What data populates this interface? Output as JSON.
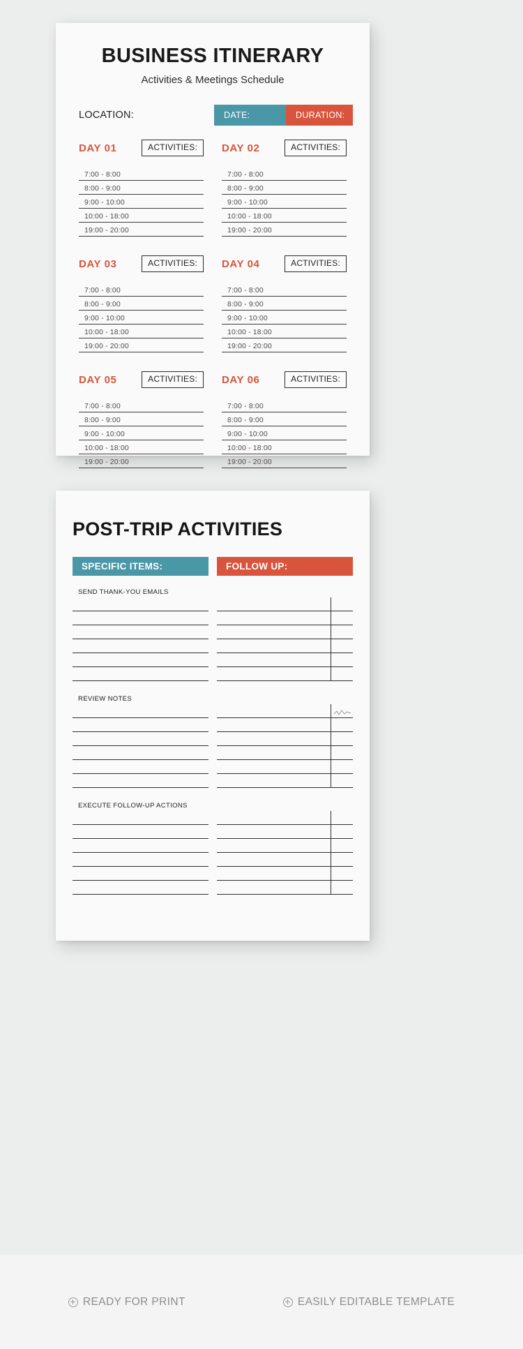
{
  "page1": {
    "title": "BUSINESS ITINERARY",
    "subtitle": "Activities & Meetings Schedule",
    "location_label": "LOCATION:",
    "date_label": "DATE:",
    "duration_label": "DURATION:",
    "activities_label": "ACTIVITIES:",
    "time_slots": [
      "7:00 - 8:00",
      "8:00 - 9:00",
      "9:00 - 10:00",
      "10:00 - 18:00",
      "19:00 - 20:00"
    ],
    "days": [
      {
        "name": "DAY 01"
      },
      {
        "name": "DAY 02"
      },
      {
        "name": "DAY 03"
      },
      {
        "name": "DAY 04"
      },
      {
        "name": "DAY 05"
      },
      {
        "name": "DAY 06"
      }
    ]
  },
  "page2": {
    "title": "POST-TRIP ACTIVITIES",
    "specific_items_label": "SPECIFIC ITEMS:",
    "follow_up_label": "FOLLOW UP:",
    "sections": [
      {
        "label": "SEND THANK-YOU EMAILS",
        "rule_count": 6
      },
      {
        "label": "REVIEW NOTES",
        "rule_count": 6
      },
      {
        "label": "EXECUTE FOLLOW-UP ACTIONS",
        "rule_count": 6
      }
    ],
    "follow_up_blocks": [
      {
        "rule_count": 6
      },
      {
        "rule_count": 6
      },
      {
        "rule_count": 6
      }
    ]
  },
  "footer": {
    "items": [
      {
        "icon": "plus-circle-icon",
        "label": "READY FOR PRINT"
      },
      {
        "icon": "plus-circle-icon",
        "label": "EASILY EDITABLE TEMPLATE"
      }
    ]
  },
  "colors": {
    "teal": "#4a97a8",
    "orange": "#d9543c",
    "page_bg": "#eceded",
    "sheet_bg": "#fafafa",
    "footer_bg": "#f4f4f4",
    "rule": "#2e2e2e"
  }
}
